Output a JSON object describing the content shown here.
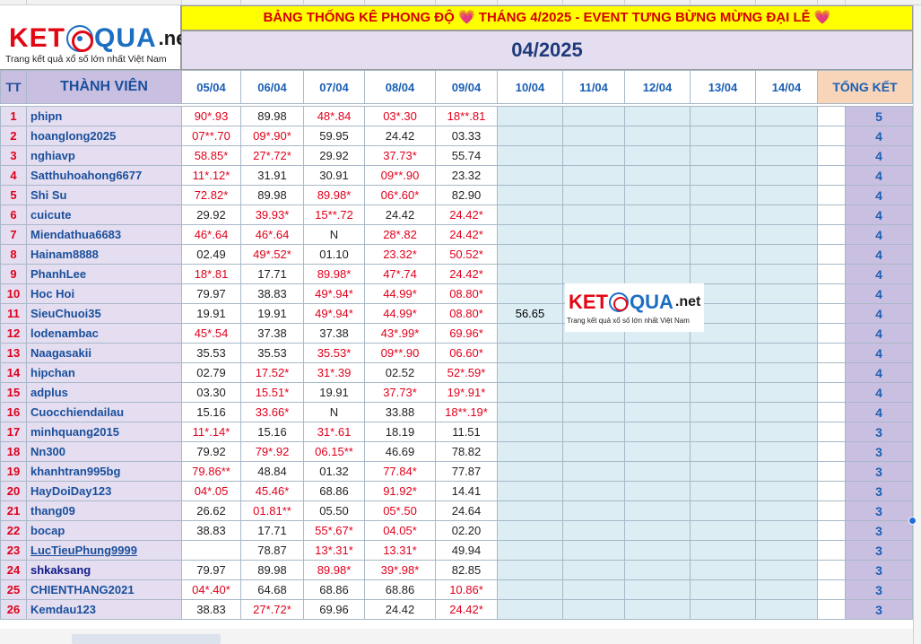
{
  "logo": {
    "ket": "KET",
    "qua": "QUA",
    "net": ".net",
    "tagline": "Trang kết quả xổ số lớn nhất Việt Nam"
  },
  "title": "BẢNG THỐNG KÊ PHONG ĐỘ 💗  THÁNG 4/2025 - EVENT TƯNG BỪNG MỪNG ĐẠI LỄ 💗",
  "month": "04/2025",
  "headers": {
    "tt": "TT",
    "member": "THÀNH VIÊN",
    "total": "TỔNG KẾT",
    "dates": [
      "05/04",
      "06/04",
      "07/04",
      "08/04",
      "09/04",
      "10/04",
      "11/04",
      "12/04",
      "13/04",
      "14/04"
    ]
  },
  "colors": {
    "title_bg": "#ffff00",
    "title_text": "#d40000",
    "header_purple": "#c9bfe0",
    "name_bg": "#e4def0",
    "total_header_bg": "#f8d4b8",
    "empty_cell_bg": "#dcedf3",
    "hit_text": "#e0001b",
    "header_text": "#1a5fb4"
  },
  "rows": [
    {
      "tt": "1",
      "name": "phipn",
      "style": "",
      "vals": [
        {
          "t": "90*.93",
          "hit": true
        },
        {
          "t": "89.98",
          "hit": false
        },
        {
          "t": "48*.84",
          "hit": true
        },
        {
          "t": "03*.30",
          "hit": true
        },
        {
          "t": "18**.81",
          "hit": true
        }
      ],
      "extra": "",
      "total": "5"
    },
    {
      "tt": "2",
      "name": "hoanglong2025",
      "style": "",
      "vals": [
        {
          "t": "07**.70",
          "hit": true
        },
        {
          "t": "09*.90*",
          "hit": true
        },
        {
          "t": "59.95",
          "hit": false
        },
        {
          "t": "24.42",
          "hit": false
        },
        {
          "t": "03.33",
          "hit": false
        }
      ],
      "extra": "",
      "total": "4"
    },
    {
      "tt": "3",
      "name": "nghiavp",
      "style": "",
      "vals": [
        {
          "t": "58.85*",
          "hit": true
        },
        {
          "t": "27*.72*",
          "hit": true
        },
        {
          "t": "29.92",
          "hit": false
        },
        {
          "t": "37.73*",
          "hit": true
        },
        {
          "t": "55.74",
          "hit": false
        }
      ],
      "extra": "",
      "total": "4"
    },
    {
      "tt": "4",
      "name": "Satthuhoahong6677",
      "style": "",
      "vals": [
        {
          "t": "11*.12*",
          "hit": true
        },
        {
          "t": "31.91",
          "hit": false
        },
        {
          "t": "30.91",
          "hit": false
        },
        {
          "t": "09**.90",
          "hit": true
        },
        {
          "t": "23.32",
          "hit": false
        }
      ],
      "extra": "",
      "total": "4"
    },
    {
      "tt": "5",
      "name": "Shi Su",
      "style": "",
      "vals": [
        {
          "t": "72.82*",
          "hit": true
        },
        {
          "t": "89.98",
          "hit": false
        },
        {
          "t": "89.98*",
          "hit": true
        },
        {
          "t": "06*.60*",
          "hit": true
        },
        {
          "t": "82.90",
          "hit": false
        }
      ],
      "extra": "",
      "total": "4"
    },
    {
      "tt": "6",
      "name": "cuicute",
      "style": "",
      "vals": [
        {
          "t": "29.92",
          "hit": false
        },
        {
          "t": "39.93*",
          "hit": true
        },
        {
          "t": "15**.72",
          "hit": true
        },
        {
          "t": "24.42",
          "hit": false
        },
        {
          "t": "24.42*",
          "hit": true
        }
      ],
      "extra": "",
      "total": "4"
    },
    {
      "tt": "7",
      "name": "Miendathua6683",
      "style": "",
      "vals": [
        {
          "t": "46*.64",
          "hit": true
        },
        {
          "t": "46*.64",
          "hit": true
        },
        {
          "t": "N",
          "hit": false
        },
        {
          "t": "28*.82",
          "hit": true
        },
        {
          "t": "24.42*",
          "hit": true
        }
      ],
      "extra": "",
      "total": "4"
    },
    {
      "tt": "8",
      "name": "Hainam8888",
      "style": "",
      "vals": [
        {
          "t": "02.49",
          "hit": false
        },
        {
          "t": "49*.52*",
          "hit": true
        },
        {
          "t": "01.10",
          "hit": false
        },
        {
          "t": "23.32*",
          "hit": true
        },
        {
          "t": "50.52*",
          "hit": true
        }
      ],
      "extra": "",
      "total": "4"
    },
    {
      "tt": "9",
      "name": "PhanhLee",
      "style": "",
      "vals": [
        {
          "t": "18*.81",
          "hit": true
        },
        {
          "t": "17.71",
          "hit": false
        },
        {
          "t": "89.98*",
          "hit": true
        },
        {
          "t": "47*.74",
          "hit": true
        },
        {
          "t": "24.42*",
          "hit": true
        }
      ],
      "extra": "",
      "total": "4"
    },
    {
      "tt": "10",
      "name": "Hoc Hoi",
      "style": "",
      "vals": [
        {
          "t": "79.97",
          "hit": false
        },
        {
          "t": "38.83",
          "hit": false
        },
        {
          "t": "49*.94*",
          "hit": true
        },
        {
          "t": "44.99*",
          "hit": true
        },
        {
          "t": "08.80*",
          "hit": true
        }
      ],
      "extra": "",
      "total": "4"
    },
    {
      "tt": "11",
      "name": "SieuChuoi35",
      "style": "",
      "vals": [
        {
          "t": "19.91",
          "hit": false
        },
        {
          "t": "19.91",
          "hit": false
        },
        {
          "t": "49*.94*",
          "hit": true
        },
        {
          "t": "44.99*",
          "hit": true
        },
        {
          "t": "08.80*",
          "hit": true
        }
      ],
      "extra": "56.65",
      "total": "4"
    },
    {
      "tt": "12",
      "name": "lodenambac",
      "style": "",
      "vals": [
        {
          "t": "45*.54",
          "hit": true
        },
        {
          "t": "37.38",
          "hit": false
        },
        {
          "t": "37.38",
          "hit": false
        },
        {
          "t": "43*.99*",
          "hit": true
        },
        {
          "t": "69.96*",
          "hit": true
        }
      ],
      "extra": "",
      "total": "4"
    },
    {
      "tt": "13",
      "name": "Naagasakii",
      "style": "",
      "vals": [
        {
          "t": "35.53",
          "hit": false
        },
        {
          "t": "35.53",
          "hit": false
        },
        {
          "t": "35.53*",
          "hit": true
        },
        {
          "t": "09**.90",
          "hit": true
        },
        {
          "t": "06.60*",
          "hit": true
        }
      ],
      "extra": "",
      "total": "4"
    },
    {
      "tt": "14",
      "name": "hipchan",
      "style": "",
      "vals": [
        {
          "t": "02.79",
          "hit": false
        },
        {
          "t": "17.52*",
          "hit": true
        },
        {
          "t": "31*.39",
          "hit": true
        },
        {
          "t": "02.52",
          "hit": false
        },
        {
          "t": "52*.59*",
          "hit": true
        }
      ],
      "extra": "",
      "total": "4"
    },
    {
      "tt": "15",
      "name": "adplus",
      "style": "",
      "vals": [
        {
          "t": "03.30",
          "hit": false
        },
        {
          "t": "15.51*",
          "hit": true
        },
        {
          "t": "19.91",
          "hit": false
        },
        {
          "t": "37.73*",
          "hit": true
        },
        {
          "t": "19*.91*",
          "hit": true
        }
      ],
      "extra": "",
      "total": "4"
    },
    {
      "tt": "16",
      "name": "Cuocchiendailau",
      "style": "",
      "vals": [
        {
          "t": "15.16",
          "hit": false
        },
        {
          "t": "33.66*",
          "hit": true
        },
        {
          "t": "N",
          "hit": false
        },
        {
          "t": "33.88",
          "hit": false
        },
        {
          "t": "18**.19*",
          "hit": true
        }
      ],
      "extra": "",
      "total": "4"
    },
    {
      "tt": "17",
      "name": "minhquang2015",
      "style": "",
      "vals": [
        {
          "t": "11*.14*",
          "hit": true
        },
        {
          "t": "15.16",
          "hit": false
        },
        {
          "t": "31*.61",
          "hit": true
        },
        {
          "t": "18.19",
          "hit": false
        },
        {
          "t": "11.51",
          "hit": false
        }
      ],
      "extra": "",
      "total": "3"
    },
    {
      "tt": "18",
      "name": "Nn300",
      "style": "",
      "vals": [
        {
          "t": "79.92",
          "hit": false
        },
        {
          "t": "79*.92",
          "hit": true
        },
        {
          "t": "06.15**",
          "hit": true
        },
        {
          "t": "46.69",
          "hit": false
        },
        {
          "t": "78.82",
          "hit": false
        }
      ],
      "extra": "",
      "total": "3"
    },
    {
      "tt": "19",
      "name": "khanhtran995bg",
      "style": "",
      "vals": [
        {
          "t": "79.86**",
          "hit": true
        },
        {
          "t": "48.84",
          "hit": false
        },
        {
          "t": "01.32",
          "hit": false
        },
        {
          "t": "77.84*",
          "hit": true
        },
        {
          "t": "77.87",
          "hit": false
        }
      ],
      "extra": "",
      "total": "3"
    },
    {
      "tt": "20",
      "name": "HayDoiDay123",
      "style": "",
      "vals": [
        {
          "t": "04*.05",
          "hit": true
        },
        {
          "t": "45.46*",
          "hit": true
        },
        {
          "t": "68.86",
          "hit": false
        },
        {
          "t": "91.92*",
          "hit": true
        },
        {
          "t": "14.41",
          "hit": false
        }
      ],
      "extra": "",
      "total": "3"
    },
    {
      "tt": "21",
      "name": "thang09",
      "style": "",
      "vals": [
        {
          "t": "26.62",
          "hit": false
        },
        {
          "t": "01.81**",
          "hit": true
        },
        {
          "t": "05.50",
          "hit": false
        },
        {
          "t": "05*.50",
          "hit": true
        },
        {
          "t": "24.64",
          "hit": false
        }
      ],
      "extra": "",
      "total": "3"
    },
    {
      "tt": "22",
      "name": "bocap",
      "style": "",
      "vals": [
        {
          "t": "38.83",
          "hit": false
        },
        {
          "t": "17.71",
          "hit": false
        },
        {
          "t": "55*.67*",
          "hit": true
        },
        {
          "t": "04.05*",
          "hit": true
        },
        {
          "t": "02.20",
          "hit": false
        }
      ],
      "extra": "",
      "total": "3"
    },
    {
      "tt": "23",
      "name": "LucTieuPhung9999",
      "style": "link",
      "vals": [
        {
          "t": "",
          "hit": false
        },
        {
          "t": "78.87",
          "hit": false
        },
        {
          "t": "13*.31*",
          "hit": true
        },
        {
          "t": "13.31*",
          "hit": true
        },
        {
          "t": "49.94",
          "hit": false
        }
      ],
      "extra": "",
      "total": "3"
    },
    {
      "tt": "24",
      "name": "shkaksang",
      "style": "dark",
      "vals": [
        {
          "t": "79.97",
          "hit": false
        },
        {
          "t": "89.98",
          "hit": false
        },
        {
          "t": "89.98*",
          "hit": true
        },
        {
          "t": "39*.98*",
          "hit": true
        },
        {
          "t": "82.85",
          "hit": false
        }
      ],
      "extra": "",
      "total": "3"
    },
    {
      "tt": "25",
      "name": "CHIENTHANG2021",
      "style": "",
      "vals": [
        {
          "t": "04*.40*",
          "hit": true
        },
        {
          "t": "64.68",
          "hit": false
        },
        {
          "t": "68.86",
          "hit": false
        },
        {
          "t": "68.86",
          "hit": false
        },
        {
          "t": "10.86*",
          "hit": true
        }
      ],
      "extra": "",
      "total": "3"
    },
    {
      "tt": "26",
      "name": "Kemdau123",
      "style": "",
      "vals": [
        {
          "t": "38.83",
          "hit": false
        },
        {
          "t": "27*.72*",
          "hit": true
        },
        {
          "t": "69.96",
          "hit": false
        },
        {
          "t": "24.42",
          "hit": false
        },
        {
          "t": "24.42*",
          "hit": true
        }
      ],
      "extra": "",
      "total": "3"
    }
  ]
}
